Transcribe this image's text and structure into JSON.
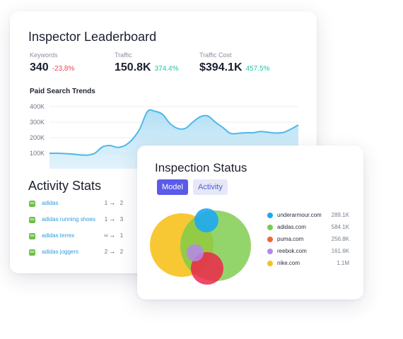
{
  "leaderboard": {
    "title": "Inspector Leaderboard",
    "metrics": [
      {
        "label": "Keywords",
        "value": "340",
        "change": "-23.8%",
        "trend": "down"
      },
      {
        "label": "Traffic",
        "value": "150.8K",
        "change": "374.4%",
        "trend": "up"
      },
      {
        "label": "Traffic Cost",
        "value": "$394.1K",
        "change": "457.5%",
        "trend": "up"
      }
    ],
    "trends_title": "Paid Search Trends"
  },
  "chart_data": {
    "type": "area",
    "title": "Paid Search Trends",
    "y_ticks": [
      "400K",
      "300K",
      "200K",
      "100K"
    ],
    "ylim": [
      0,
      400000
    ],
    "grid": true,
    "color": "#4fb8e8",
    "values": [
      100000,
      100000,
      98000,
      95000,
      90000,
      88000,
      100000,
      140000,
      150000,
      138000,
      150000,
      190000,
      260000,
      370000,
      370000,
      350000,
      290000,
      260000,
      260000,
      300000,
      335000,
      340000,
      300000,
      265000,
      228000,
      228000,
      232000,
      232000,
      240000,
      235000,
      230000,
      234000,
      255000,
      282000
    ]
  },
  "activity": {
    "title": "Activity Stats",
    "rows": [
      {
        "badge": "kw",
        "label": "adidas",
        "from": "1",
        "to": "2"
      },
      {
        "badge": "kw",
        "label": "adidas running shoes",
        "from": "1",
        "to": "3"
      },
      {
        "badge": "kw",
        "label": "adidas terrex",
        "from": "∞",
        "to": "1"
      },
      {
        "badge": "kw",
        "label": "adidas joggers",
        "from": "2",
        "to": "2"
      }
    ],
    "arrow": "→"
  },
  "inspection": {
    "title": "Inspection Status",
    "tabs": [
      {
        "label": "Model",
        "active": true
      },
      {
        "label": "Activity",
        "active": false
      }
    ],
    "legend": [
      {
        "name": "underarmour.com",
        "value": "289.1K",
        "color": "#1ea8f0"
      },
      {
        "name": "adidas.com",
        "value": "584.1K",
        "color": "#7ccc4a"
      },
      {
        "name": "puma.com",
        "value": "256.8K",
        "color": "#f2663c"
      },
      {
        "name": "reebok.com",
        "value": "161.6K",
        "color": "#b687ef"
      },
      {
        "name": "nike.com",
        "value": "1.1M",
        "color": "#f7c21e"
      }
    ]
  }
}
